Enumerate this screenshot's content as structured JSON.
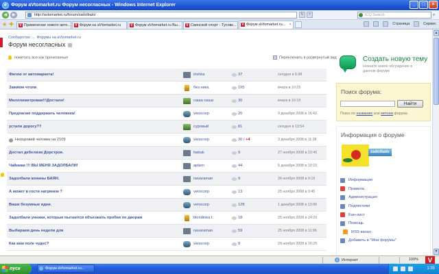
{
  "window": {
    "title": "Форум aVtomarket.ru Форум несогласных - Windows Internet Explorer"
  },
  "address": {
    "url": "http://avtomarket.ru/forum/zadolbalo/",
    "search_placeholder": "ICQ Search"
  },
  "tabs": [
    {
      "label": "Применение нового авто..."
    },
    {
      "label": "Форум на aVtomarket.ru"
    },
    {
      "label": "Форум aVtomarket.ru Вы..."
    },
    {
      "label": "Свинской спорт - Тусовк..."
    },
    {
      "label": "Форум aVtomarket.ru..."
    }
  ],
  "tools": {
    "page": "Страница",
    "service": "Сервис"
  },
  "breadcrumb": {
    "root": "Сообщество",
    "section": "Форумы на aVtomarket.ru"
  },
  "forum_title": "Форум несогласных",
  "mark_all_read": "пометить все как прочитанные",
  "expand_view": "Переключить в развернутый вид",
  "topics": [
    {
      "title": "Фигею от автомаркета!",
      "author": "irishka",
      "replies": "37",
      "new": "",
      "date": "сегодня в 6:38",
      "bold": true
    },
    {
      "title": "Зажжом чтоли",
      "author": "без ника",
      "replies": "195",
      "new": "",
      "date": "вчера в 10:29",
      "bold": true
    },
    {
      "title": "Милллиметровки!!!Достали!",
      "author": "саша саша",
      "replies": "30",
      "new": "",
      "date": "вчера в 16:18",
      "bold": true
    },
    {
      "title": "Предлагаю поддержать человека!",
      "author": "venscorp",
      "replies": "20",
      "new": "",
      "date": "9 декабря 2008 в 16:43",
      "bold": true
    },
    {
      "title": "устали дорогу??",
      "author": "суровый",
      "replies": "81",
      "new": "",
      "date": "сегодня в 13:54",
      "bold": true
    },
    {
      "title": "Нехоровий человек на 2109",
      "author": "venscorp",
      "replies": "30",
      "new": "+4",
      "date": "3 декабря 2008 в 11:28",
      "bold": false
    },
    {
      "title": "Достал дебелизм Дорстроя.",
      "author": "hatrak",
      "replies": "9",
      "new": "",
      "date": "27 ноября 2008 в 22:46",
      "bold": true
    },
    {
      "title": "Чайники !!! ВЫ МЕНЯ ЗАДОЛБАЛИ!",
      "author": "aptem",
      "replies": "44",
      "new": "",
      "date": "5 декабря 2008 в 19:23",
      "bold": true
    },
    {
      "title": "Задолбали конины БАЯН.",
      "author": "navaraman",
      "replies": "9",
      "new": "",
      "date": "26 ноября 2008 в 9:19",
      "bold": true
    },
    {
      "title": "А может в гости нагрянем ?",
      "author": "venscorp",
      "replies": "13",
      "new": "",
      "date": "25 ноября 2008 в 9:45",
      "bold": true
    },
    {
      "title": "Ваши безумные идеи.",
      "author": "venscorp",
      "replies": "128",
      "new": "",
      "date": "1 декабря 2008 в 13:08",
      "bold": true
    },
    {
      "title": "Задолбали унники, которые пытаются объезжать пробки по дворам",
      "author": "blondinka t",
      "replies": "18",
      "new": "",
      "date": "25 ноября 2008 в 14:20",
      "bold": true
    },
    {
      "title": "Выбираем день недели для",
      "author": "navaraman",
      "replies": "59",
      "new": "",
      "date": "25 ноября 2008 в 11:06",
      "bold": true
    },
    {
      "title": "Как вам поле чудес?",
      "author": "venscorp",
      "replies": "9",
      "new": "",
      "date": "29 ноября 2008 в 16:25",
      "bold": true
    }
  ],
  "sidebar": {
    "new_topic_title": "Создать новую тему",
    "new_topic_desc": "Начните новое обсуждение в данном форуме",
    "search_title": "Поиск форума:",
    "search_button": "Найти",
    "search_hint_prefix": "Поиск по",
    "search_hint_name": "названию",
    "search_hint_or": "или",
    "search_hint_tags": "меткам",
    "search_hint_suffix": "форума",
    "info_title": "Информация о форуме",
    "forum_name": "zadolbalo",
    "links": [
      {
        "label": "Информация",
        "icon": "info-icon"
      },
      {
        "label": "Правила",
        "icon": "rules-icon"
      },
      {
        "label": "Администрация",
        "icon": "admin-icon"
      },
      {
        "label": "Подписчики",
        "icon": "subscribers-icon"
      },
      {
        "label": "Бан-лист",
        "icon": "ban-icon"
      },
      {
        "label": "Помощь",
        "icon": "help-icon"
      },
      {
        "label": "RSS-канал",
        "icon": "rss-icon"
      },
      {
        "label": "Добавить в \"Мои форумы\"",
        "icon": "add-icon"
      }
    ]
  },
  "status": {
    "zone": "Интернет",
    "zoom": "100%"
  },
  "taskbar": {
    "start": "пуск",
    "item": "Форум aVtomarket.ru...",
    "clock": "1:35"
  }
}
